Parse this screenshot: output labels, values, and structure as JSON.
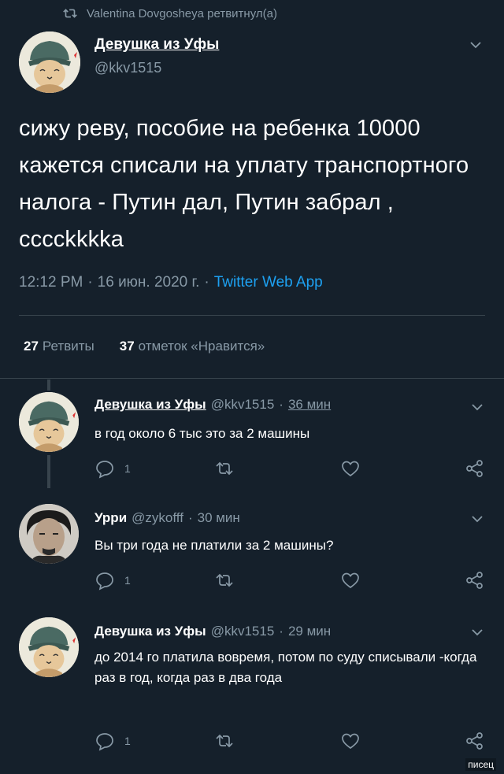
{
  "retweet_bar": {
    "text": "Valentina Dovgosheya ретвитнул(а)",
    "icon": "retweet-icon"
  },
  "main_tweet": {
    "author_name": "Девушка из Уфы",
    "author_handle": "@kkv1515",
    "text": "сижу реву, пособие на ребенка 10000 кажется списали на уплату транспортного налога - Путин дал, Путин забрал , ссссkkkkа",
    "time": "12:12 PM",
    "date": "16 июн. 2020 г.",
    "separator": "·",
    "source_app": "Twitter Web App",
    "retweets_count": "27",
    "retweets_label": "Ретвиты",
    "likes_count": "37",
    "likes_label": "отметок «Нравится»"
  },
  "replies": [
    {
      "author_name": "Девушка из Уфы",
      "author_handle": "@kkv1515",
      "separator": "·",
      "time": "36 мин",
      "text": "в год около 6 тыс это за 2 машины",
      "reply_count": "1"
    },
    {
      "author_name": "Урри",
      "author_handle": "@zykofff",
      "separator": "·",
      "time": "30 мин",
      "text": "Вы три года не платили за 2 машины?",
      "reply_count": "1"
    },
    {
      "author_name": "Девушка из Уфы",
      "author_handle": "@kkv1515",
      "separator": "·",
      "time": "29 мин",
      "text": "до 2014 го платила вовремя, потом по суду списывали -когда раз в год, когда раз в два года",
      "reply_count": "1"
    }
  ],
  "watermark": "писец",
  "colors": {
    "background": "#15202b",
    "text": "#ffffff",
    "muted": "#8899a6",
    "link": "#1da1f2",
    "divider": "#38444d"
  }
}
